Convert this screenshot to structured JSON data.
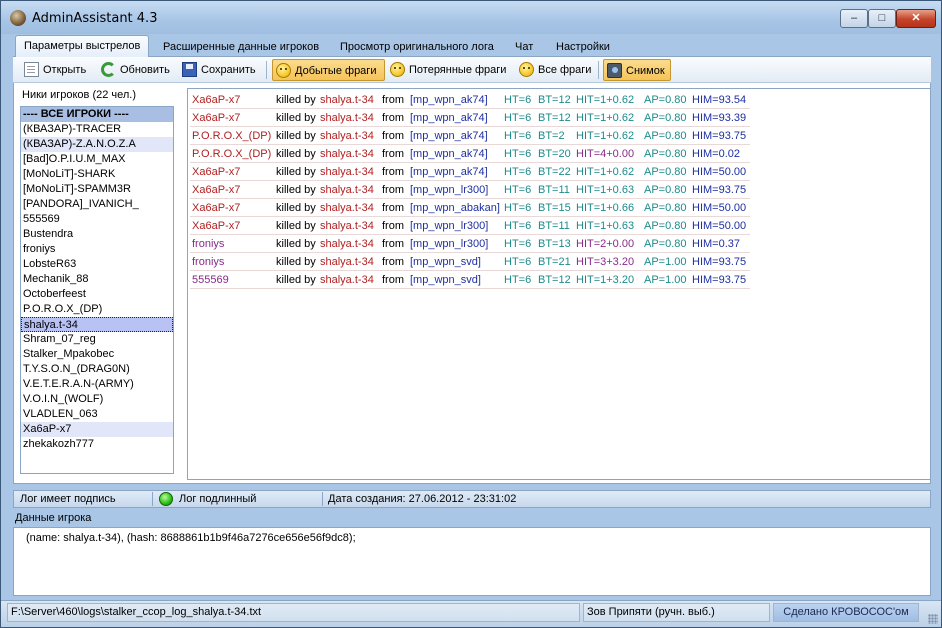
{
  "window": {
    "title": "AdminAssistant 4.3",
    "controls": {
      "minimize": "–",
      "maximize": "□",
      "close": "✕"
    }
  },
  "tabs": [
    "Параметры выстрелов",
    "Расширенные данные игроков",
    "Просмотр оригинального лога",
    "Чат",
    "Настройки"
  ],
  "toolbar": {
    "open": "Открыть",
    "refresh": "Обновить",
    "save": "Сохранить",
    "earned_frags": "Добытые фраги",
    "lost_frags": "Потерянные фраги",
    "all_frags": "Все фраги",
    "snapshot": "Снимок"
  },
  "players": {
    "label": "Ники игроков (22 чел.)",
    "items": [
      "---- ВСЕ ИГРОКИ ----",
      "(КВАЗАР)-TRACER",
      "(КВАЗАР)-Z.A.N.O.Z.A",
      "[Bad]O.P.I.U.M_MAX",
      "[MoNoLiT]-SHARK",
      "[MoNoLiT]-SPAMM3R",
      "[PANDORA]_IVANICH_",
      "555569",
      "Bustendra",
      "froniys",
      "LobsteR63",
      "Mechanik_88",
      "Octoberfeest",
      "P.O.R.O.X_(DP)",
      "shalya.t-34",
      "Shram_07_reg",
      "Stalker_Mpakobec",
      "T.Y.S.O.N_(DRAG0N)",
      "V.E.T.E.R.A.N-(ARMY)",
      "V.O.I.N_(WOLF)",
      "VLADLEN_063",
      "Xa6aP-x7",
      "zhekakozh777"
    ]
  },
  "frags": [
    {
      "killer": "Xa6aP-x7",
      "by": "killed by",
      "victim": "shalya.t-34",
      "from": "from",
      "weapon": "[mp_wpn_ak74]",
      "ht": "HT=6",
      "bt": "BT=12",
      "hit": "HIT=1+0.62",
      "ap": "AP=0.80",
      "him": "HIM=93.54"
    },
    {
      "killer": "Xa6aP-x7",
      "by": "killed by",
      "victim": "shalya.t-34",
      "from": "from",
      "weapon": "[mp_wpn_ak74]",
      "ht": "HT=6",
      "bt": "BT=12",
      "hit": "HIT=1+0.62",
      "ap": "AP=0.80",
      "him": "HIM=93.39"
    },
    {
      "killer": "P.O.R.O.X_(DP)",
      "by": "killed by",
      "victim": "shalya.t-34",
      "from": "from",
      "weapon": "[mp_wpn_ak74]",
      "ht": "HT=6",
      "bt": "BT=2",
      "hit": "HIT=1+0.62",
      "ap": "AP=0.80",
      "him": "HIM=93.75"
    },
    {
      "killer": "P.O.R.O.X_(DP)",
      "by": "killed by",
      "victim": "shalya.t-34",
      "from": "from",
      "weapon": "[mp_wpn_ak74]",
      "ht": "HT=6",
      "bt": "BT=20",
      "hit": "HIT=4+0.00",
      "ap": "AP=0.80",
      "him": "HIM=0.02"
    },
    {
      "killer": "Xa6aP-x7",
      "by": "killed by",
      "victim": "shalya.t-34",
      "from": "from",
      "weapon": "[mp_wpn_ak74]",
      "ht": "HT=6",
      "bt": "BT=22",
      "hit": "HIT=1+0.62",
      "ap": "AP=0.80",
      "him": "HIM=50.00"
    },
    {
      "killer": "Xa6aP-x7",
      "by": "killed by",
      "victim": "shalya.t-34",
      "from": "from",
      "weapon": "[mp_wpn_lr300]",
      "ht": "HT=6",
      "bt": "BT=11",
      "hit": "HIT=1+0.63",
      "ap": "AP=0.80",
      "him": "HIM=93.75"
    },
    {
      "killer": "Xa6aP-x7",
      "by": "killed by",
      "victim": "shalya.t-34",
      "from": "from",
      "weapon": "[mp_wpn_abakan]",
      "ht": "HT=6",
      "bt": "BT=15",
      "hit": "HIT=1+0.66",
      "ap": "AP=0.80",
      "him": "HIM=50.00"
    },
    {
      "killer": "Xa6aP-x7",
      "by": "killed by",
      "victim": "shalya.t-34",
      "from": "from",
      "weapon": "[mp_wpn_lr300]",
      "ht": "HT=6",
      "bt": "BT=11",
      "hit": "HIT=1+0.63",
      "ap": "AP=0.80",
      "him": "HIM=50.00"
    },
    {
      "killer": "froniys",
      "by": "killed by",
      "victim": "shalya.t-34",
      "from": "from",
      "weapon": "[mp_wpn_lr300]",
      "ht": "HT=6",
      "bt": "BT=13",
      "hit": "HIT=2+0.00",
      "ap": "AP=0.80",
      "him": "HIM=0.37"
    },
    {
      "killer": "froniys",
      "by": "killed by",
      "victim": "shalya.t-34",
      "from": "from",
      "weapon": "[mp_wpn_svd]",
      "ht": "HT=6",
      "bt": "BT=21",
      "hit": "HIT=3+3.20",
      "ap": "AP=1.00",
      "him": "HIM=93.75"
    },
    {
      "killer": "555569",
      "by": "killed by",
      "victim": "shalya.t-34",
      "from": "from",
      "weapon": "[mp_wpn_svd]",
      "ht": "HT=6",
      "bt": "BT=12",
      "hit": "HIT=1+3.20",
      "ap": "AP=1.00",
      "him": "HIM=93.75"
    }
  ],
  "status_strip": {
    "signed": "Лог имеет подпись",
    "authentic": "Лог подлинный",
    "created": "Дата создания: 27.06.2012 - 23:31:02"
  },
  "player_data": {
    "label": "Данные игрока",
    "text": "(name: shalya.t-34), (hash: 8688861b1b9f46a7276ce656e56f9dc8);"
  },
  "statusbar": {
    "path": "F:\\Server\\460\\logs\\stalker_ccop_log_shalya.t-34.txt",
    "map": "Зов Припяти (ручн. выб.)",
    "credit": "Сделано КРОВОСОС'ом"
  },
  "colors": {
    "killer": "#b01f1f",
    "killer_alt": "#8a2a8a",
    "weapon": "#1f2fa0",
    "stats": "#1f8a8a",
    "active_button": "#f5c35a"
  }
}
